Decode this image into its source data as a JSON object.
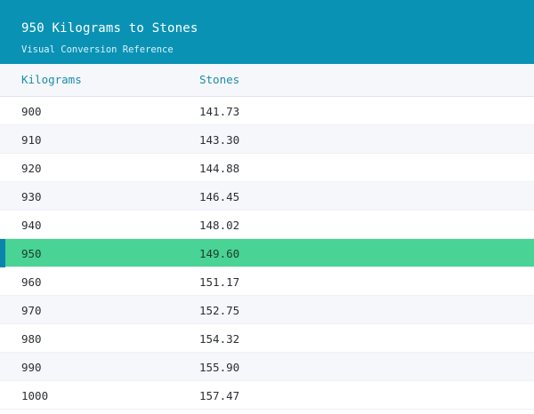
{
  "header": {
    "title": "950 Kilograms to Stones",
    "subtitle": "Visual Conversion Reference"
  },
  "table": {
    "columns": [
      "Kilograms",
      "Stones"
    ],
    "rows": [
      {
        "kg": "900",
        "stones": "141.73"
      },
      {
        "kg": "910",
        "stones": "143.30"
      },
      {
        "kg": "920",
        "stones": "144.88"
      },
      {
        "kg": "930",
        "stones": "146.45"
      },
      {
        "kg": "940",
        "stones": "148.02"
      },
      {
        "kg": "950",
        "stones": "149.60"
      },
      {
        "kg": "960",
        "stones": "151.17"
      },
      {
        "kg": "970",
        "stones": "152.75"
      },
      {
        "kg": "980",
        "stones": "154.32"
      },
      {
        "kg": "990",
        "stones": "155.90"
      },
      {
        "kg": "1000",
        "stones": "157.47"
      }
    ],
    "highlighted_kg": "950"
  },
  "colors": {
    "header_bg": "#0a92b5",
    "header_text_accent": "#1c8da6",
    "highlight_row": "#49d394",
    "highlight_marker": "#0a84ad",
    "alt_row": "#f5f7fb"
  }
}
